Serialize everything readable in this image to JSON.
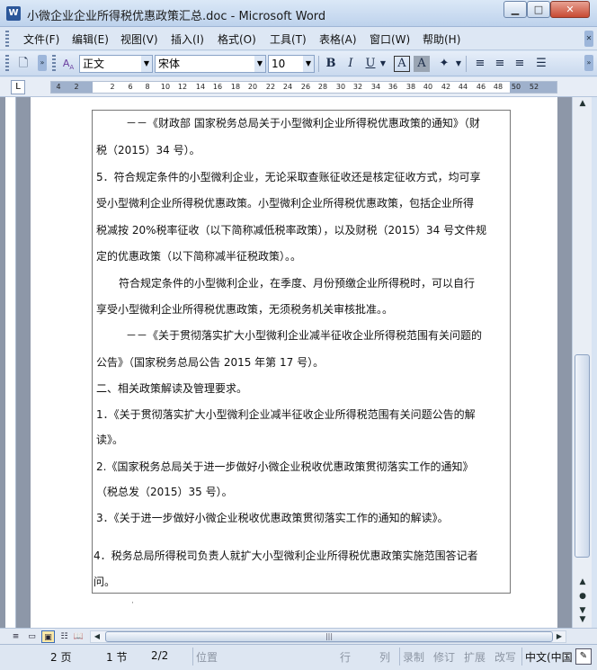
{
  "window": {
    "title": "小微企业企业所得税优惠政策汇总.doc - Microsoft Word",
    "app_icon": "W",
    "minimize": "▁",
    "maximize": "□",
    "close": "✕"
  },
  "menu": [
    "文件(F)",
    "编辑(E)",
    "视图(V)",
    "插入(I)",
    "格式(O)",
    "工具(T)",
    "表格(A)",
    "窗口(W)",
    "帮助(H)"
  ],
  "toolbar": {
    "style": "正文",
    "font": "宋体",
    "size": "10",
    "bold": "B",
    "italic": "I",
    "underline": "U",
    "char_border": "A",
    "char_shading": "A"
  },
  "ruler": {
    "numbers": [
      "4",
      "2",
      "",
      "2",
      "6",
      "8",
      "10",
      "12",
      "14",
      "16",
      "18",
      "20",
      "22",
      "24",
      "26",
      "28",
      "30",
      "32",
      "34",
      "36",
      "38",
      "40",
      "42",
      "44",
      "46",
      "48",
      "50",
      "52"
    ]
  },
  "document": {
    "lines": [
      "－－《财政部 国家税务总局关于小型微利企业所得税优惠政策的通知》（财",
      "税（2015）34 号）。",
      "5．符合规定条件的小型微利企业，无论采取查账征收还是核定征收方式，均可享",
      "受小型微利企业所得税优惠政策。小型微利企业所得税优惠政策，包括企业所得",
      "税减按 20%税率征收（以下简称减低税率政策），以及财税（2015）34 号文件规",
      "定的优惠政策（以下简称减半征税政策）。。",
      "符合规定条件的小型微利企业，在季度、月份预缴企业所得税时，可以自行",
      "享受小型微利企业所得税优惠政策，无须税务机关审核批准。。",
      "－－《关于贯彻落实扩大小型微利企业减半征收企业所得税范围有关问题的",
      "公告》（国家税务总局公告 2015 年第 17 号）。",
      "二、相关政策解读及管理要求。",
      "1．《关于贯彻落实扩大小型微利企业减半征收企业所得税范围有关问题公告的解",
      "读》。",
      "2.《国家税务总局关于进一步做好小微企业税收优惠政策贯彻落实工作的通知》",
      "（税总发（2015）35 号）。",
      "3．《关于进一步做好小微企业税收优惠政策贯彻落实工作的通知的解读》。",
      "4．税务总局所得税司负责人就扩大小型微利企业所得税优惠政策实施范围答记者",
      "问。"
    ],
    "end_mark": "·"
  },
  "status": {
    "page": "2 页",
    "section": "1 节",
    "page_of": "2/2",
    "position": "位置",
    "line": "行",
    "column": "列",
    "rec": "录制",
    "trk": "修订",
    "ext": "扩展",
    "ovr": "改写",
    "language": "中文(中国"
  }
}
